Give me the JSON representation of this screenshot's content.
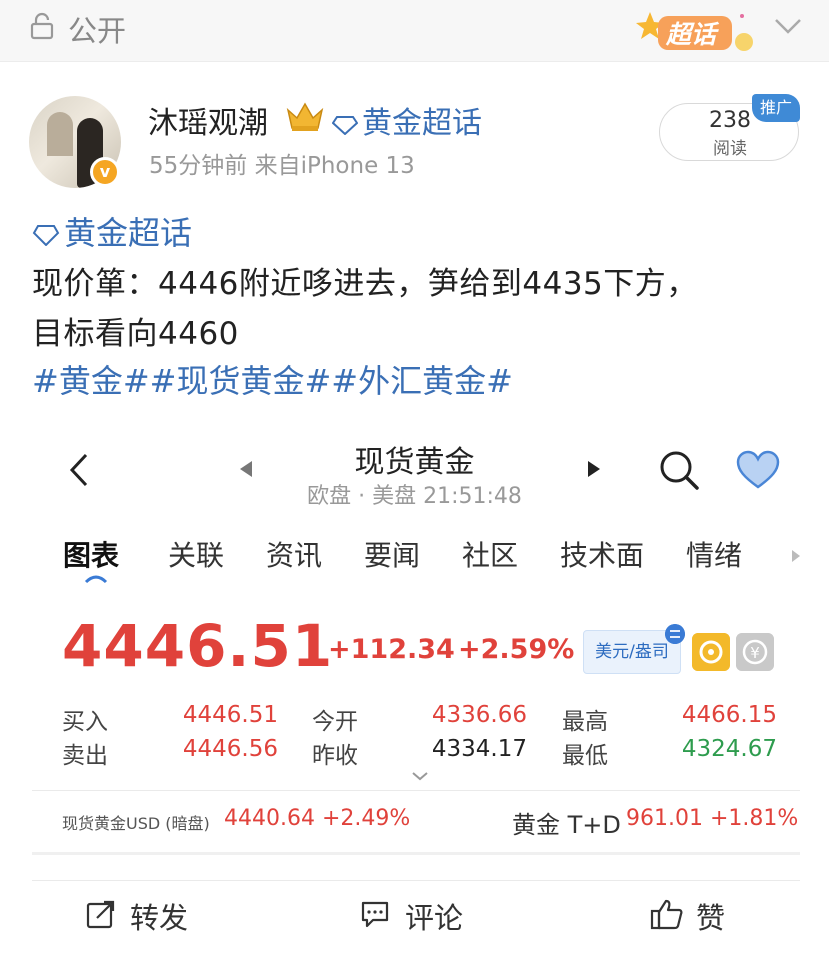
{
  "topbar": {
    "visibility_label": "公开",
    "supertopic_badge": "超话"
  },
  "post": {
    "username": "沐瑶观潮",
    "topic_link": "黄金超话",
    "meta": "55分钟前  来自iPhone 13",
    "read_count": "238",
    "read_label": "阅读",
    "promo_badge": "推广",
    "body_topic": "黄金超话",
    "body_line1": "现价箪：4446附近哆进去，笋给到4435下方，",
    "body_line2": "目标看向4460",
    "hashtags": "#黄金##现货黄金##外汇黄金#"
  },
  "card": {
    "title": "现货黄金",
    "subtitle": "欧盘 · 美盘 21:51:48",
    "tabs": [
      "图表",
      "关联",
      "资讯",
      "要闻",
      "社区",
      "技术面",
      "情绪"
    ],
    "active_tab": "图表",
    "price": "4446.51",
    "change": "+112.34",
    "change_pct": "+2.59%",
    "unit": "美元/盎司",
    "quotes": {
      "buy_label": "买入",
      "buy": "4446.51",
      "sell_label": "卖出",
      "sell": "4446.56",
      "open_label": "今开",
      "open": "4336.66",
      "prev_label": "昨收",
      "prev": "4334.17",
      "high_label": "最高",
      "high": "4466.15",
      "low_label": "最低",
      "low": "4324.67"
    },
    "related": [
      {
        "label": "现货黄金USD (暗盘)",
        "value": "4440.64 +2.49%"
      },
      {
        "label": "黄金 T+D",
        "value": "961.01 +1.81%"
      }
    ]
  },
  "actions": {
    "repost": "转发",
    "comment": "评论",
    "like": "赞"
  },
  "colors": {
    "up": "#e0423b",
    "down": "#2e9c4e",
    "link": "#3a6fb5"
  }
}
